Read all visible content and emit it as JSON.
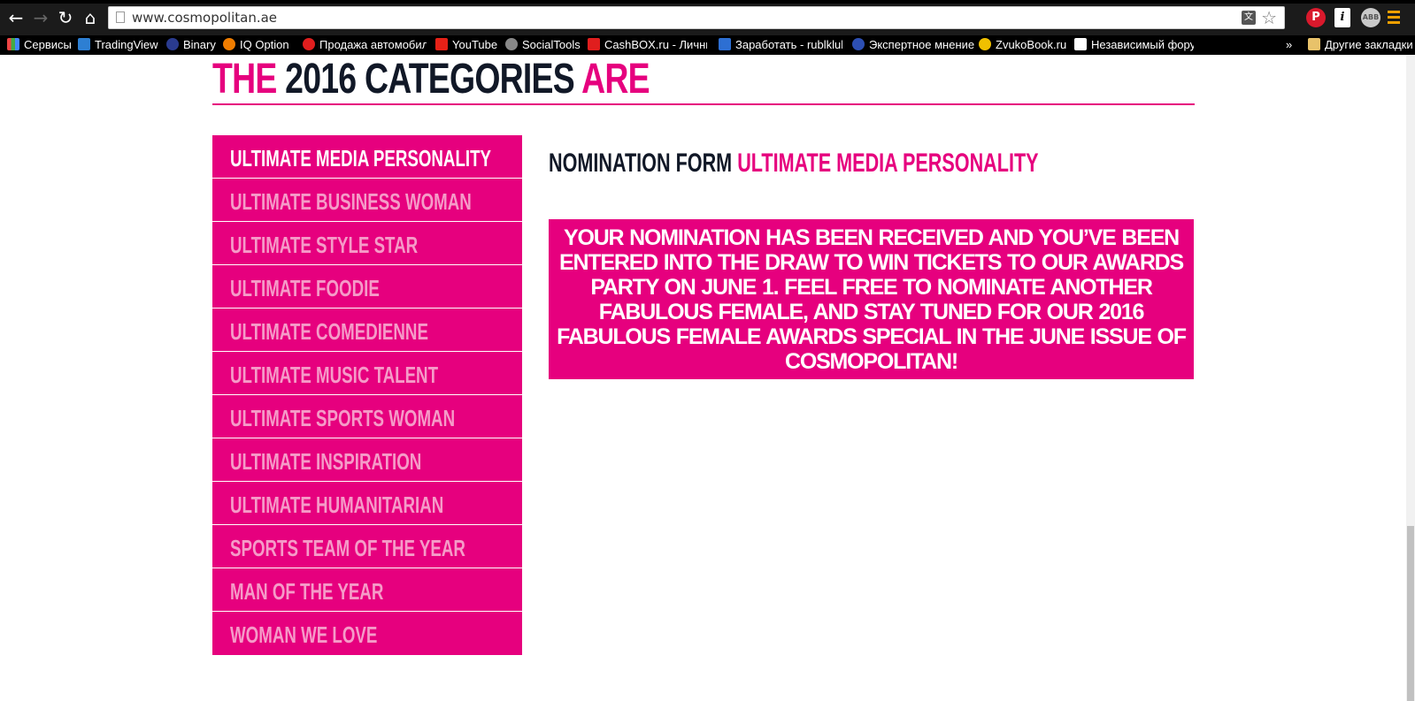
{
  "browser": {
    "url": "www.cosmopolitan.ae",
    "bookmarks": [
      {
        "label": "Сервисы"
      },
      {
        "label": "TradingView"
      },
      {
        "label": "Binary"
      },
      {
        "label": "IQ Option"
      },
      {
        "label": "Продажа автомобил"
      },
      {
        "label": "YouTube"
      },
      {
        "label": "SocialTools"
      },
      {
        "label": "CashBOX.ru - Личный"
      },
      {
        "label": "Заработать - rublklub"
      },
      {
        "label": "Экспертное мнение"
      },
      {
        "label": "ZvukoBook.ru"
      },
      {
        "label": "Независимый форум"
      }
    ],
    "bookmarks_overflow": "»",
    "other_bookmarks": "Другие закладки"
  },
  "page": {
    "title_the": "THE",
    "title_middle": "2016 CATEGORIES",
    "title_are": "ARE",
    "categories": [
      {
        "label": "ULTIMATE MEDIA PERSONALITY",
        "active": true
      },
      {
        "label": "ULTIMATE BUSINESS WOMAN",
        "active": false
      },
      {
        "label": "ULTIMATE STYLE STAR",
        "active": false
      },
      {
        "label": "ULTIMATE FOODIE",
        "active": false
      },
      {
        "label": "ULTIMATE COMEDIENNE",
        "active": false
      },
      {
        "label": "ULTIMATE MUSIC TALENT",
        "active": false
      },
      {
        "label": "ULTIMATE SPORTS WOMAN",
        "active": false
      },
      {
        "label": "ULTIMATE INSPIRATION",
        "active": false
      },
      {
        "label": "ULTIMATE HUMANITARIAN",
        "active": false
      },
      {
        "label": "SPORTS TEAM OF THE YEAR",
        "active": false
      },
      {
        "label": "MAN OF THE YEAR",
        "active": false
      },
      {
        "label": "WOMAN WE LOVE",
        "active": false
      }
    ],
    "form_heading_prefix": "NOMINATION FORM",
    "form_heading_category": "ULTIMATE MEDIA PERSONALITY",
    "confirmation": "YOUR NOMINATION HAS BEEN RECEIVED AND YOU’VE BEEN ENTERED INTO THE DRAW TO WIN TICKETS TO OUR AWARDS PARTY ON JUNE 1. FEEL FREE TO NOMINATE ANOTHER FABULOUS FEMALE, AND STAY TUNED FOR OUR 2016 FABULOUS FEMALE AWARDS SPECIAL IN THE JUNE ISSUE OF COSMOPOLITAN!"
  },
  "colors": {
    "brand_pink": "#e6007e",
    "inactive_label": "#f59bc8",
    "dark_text": "#111827"
  }
}
